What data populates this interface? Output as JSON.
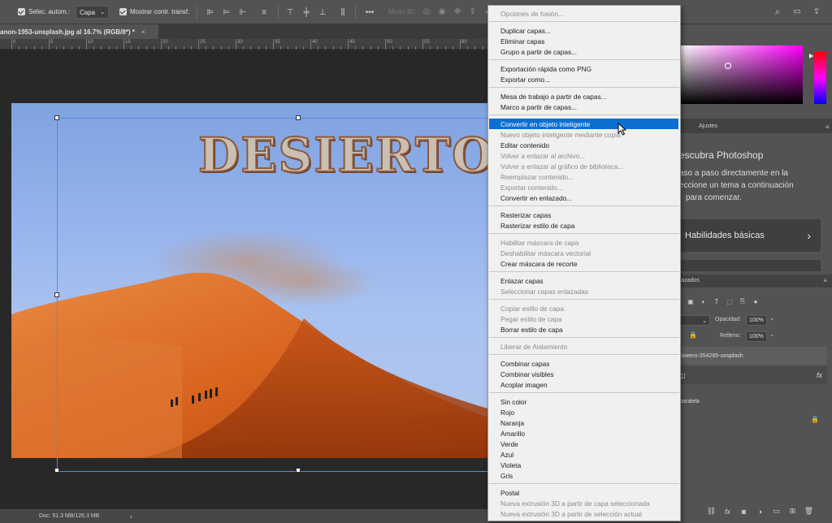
{
  "options_bar": {
    "auto_select_label": "Selec. autom.:",
    "auto_select_value": "Capa",
    "show_transform_label": "Mostrar contr. transf.",
    "mode_3d_label": "Modo 3D:",
    "more_label": "•••"
  },
  "document": {
    "tab_title": "anon-1953-unsplash.jpg al 16.7% (RGB/8*) *",
    "tab_close": "×",
    "canvas_text": "DESIERTO",
    "status_doc": "Doc: 51.3 MB/126.3 MB",
    "status_arrow": "›"
  },
  "ruler": {
    "labels": [
      "0",
      "5",
      "10",
      "15",
      "20",
      "25",
      "30",
      "35",
      "40",
      "45",
      "50",
      "55",
      "60"
    ]
  },
  "panels": {
    "tab_ajustes": "Ajustes",
    "learn_title": "escubra Photoshop",
    "learn_text_1": "aso a paso directamente en la",
    "learn_text_2": "eccione un tema a continuación",
    "learn_text_3": "para comenzar.",
    "learn_card": "Habilidades básicas",
    "learn_chevron": "›",
    "layers_tab": "razados",
    "opacity_label": "Opacidad:",
    "opacity_value": "100%",
    "fill_label": "Relleno:",
    "fill_value": "100%",
    "layer_name": "-owens-354285-unsplash",
    "layer_fx": "fx",
    "layer_effect": "paralela"
  },
  "context_menu": {
    "items": [
      {
        "label": "Opciones de fusión...",
        "disabled": true
      },
      {
        "sep": true
      },
      {
        "label": "Duplicar capas..."
      },
      {
        "label": "Eliminar capas"
      },
      {
        "label": "Grupo a partir de capas..."
      },
      {
        "sep": true
      },
      {
        "label": "Exportación rápida como PNG"
      },
      {
        "label": "Exportar como..."
      },
      {
        "sep": true
      },
      {
        "label": "Mesa de trabajo a partir de capas..."
      },
      {
        "label": "Marco a partir de capas..."
      },
      {
        "sep": true
      },
      {
        "label": "Convertir en objeto inteligente",
        "highlighted": true
      },
      {
        "label": "Nuevo objeto inteligente mediante copia",
        "disabled": true
      },
      {
        "label": "Editar contenido"
      },
      {
        "label": "Volver a enlazar al archivo...",
        "disabled": true
      },
      {
        "label": "Volver a enlazar al gráfico de biblioteca...",
        "disabled": true
      },
      {
        "label": "Reemplazar contenido...",
        "disabled": true
      },
      {
        "label": "Exportar contenido...",
        "disabled": true
      },
      {
        "label": "Convertir en enlazado..."
      },
      {
        "sep": true
      },
      {
        "label": "Rasterizar capas"
      },
      {
        "label": "Rasterizar estilo de capa"
      },
      {
        "sep": true
      },
      {
        "label": "Habilitar máscara de capa",
        "disabled": true
      },
      {
        "label": "Deshabilitar máscara vectorial",
        "disabled": true
      },
      {
        "label": "Crear máscara de recorte"
      },
      {
        "sep": true
      },
      {
        "label": "Enlazar capas"
      },
      {
        "label": "Seleccionar capas enlazadas",
        "disabled": true
      },
      {
        "sep": true
      },
      {
        "label": "Copiar estilo de capa",
        "disabled": true
      },
      {
        "label": "Pegar estilo de capa",
        "disabled": true
      },
      {
        "label": "Borrar estilo de capa"
      },
      {
        "sep": true
      },
      {
        "label": "Liberar de Aislamiento",
        "disabled": true
      },
      {
        "sep": true
      },
      {
        "label": "Combinar capas"
      },
      {
        "label": "Combinar visibles"
      },
      {
        "label": "Acoplar imagen"
      },
      {
        "sep": true
      },
      {
        "label": "Sin color"
      },
      {
        "label": "Rojo"
      },
      {
        "label": "Naranja"
      },
      {
        "label": "Amarillo"
      },
      {
        "label": "Verde"
      },
      {
        "label": "Azul"
      },
      {
        "label": "Violeta"
      },
      {
        "label": "Gris"
      },
      {
        "sep": true
      },
      {
        "label": "Postal"
      },
      {
        "label": "Nueva extrusión 3D a partir de capa seleccionada",
        "disabled": true
      },
      {
        "label": "Nueva extrusión 3D a partir de selección actual",
        "disabled": true
      }
    ]
  },
  "colors": {
    "accent": "#0b6fd0",
    "bbox": "#5a8cd8",
    "dune": "#d9651f"
  }
}
